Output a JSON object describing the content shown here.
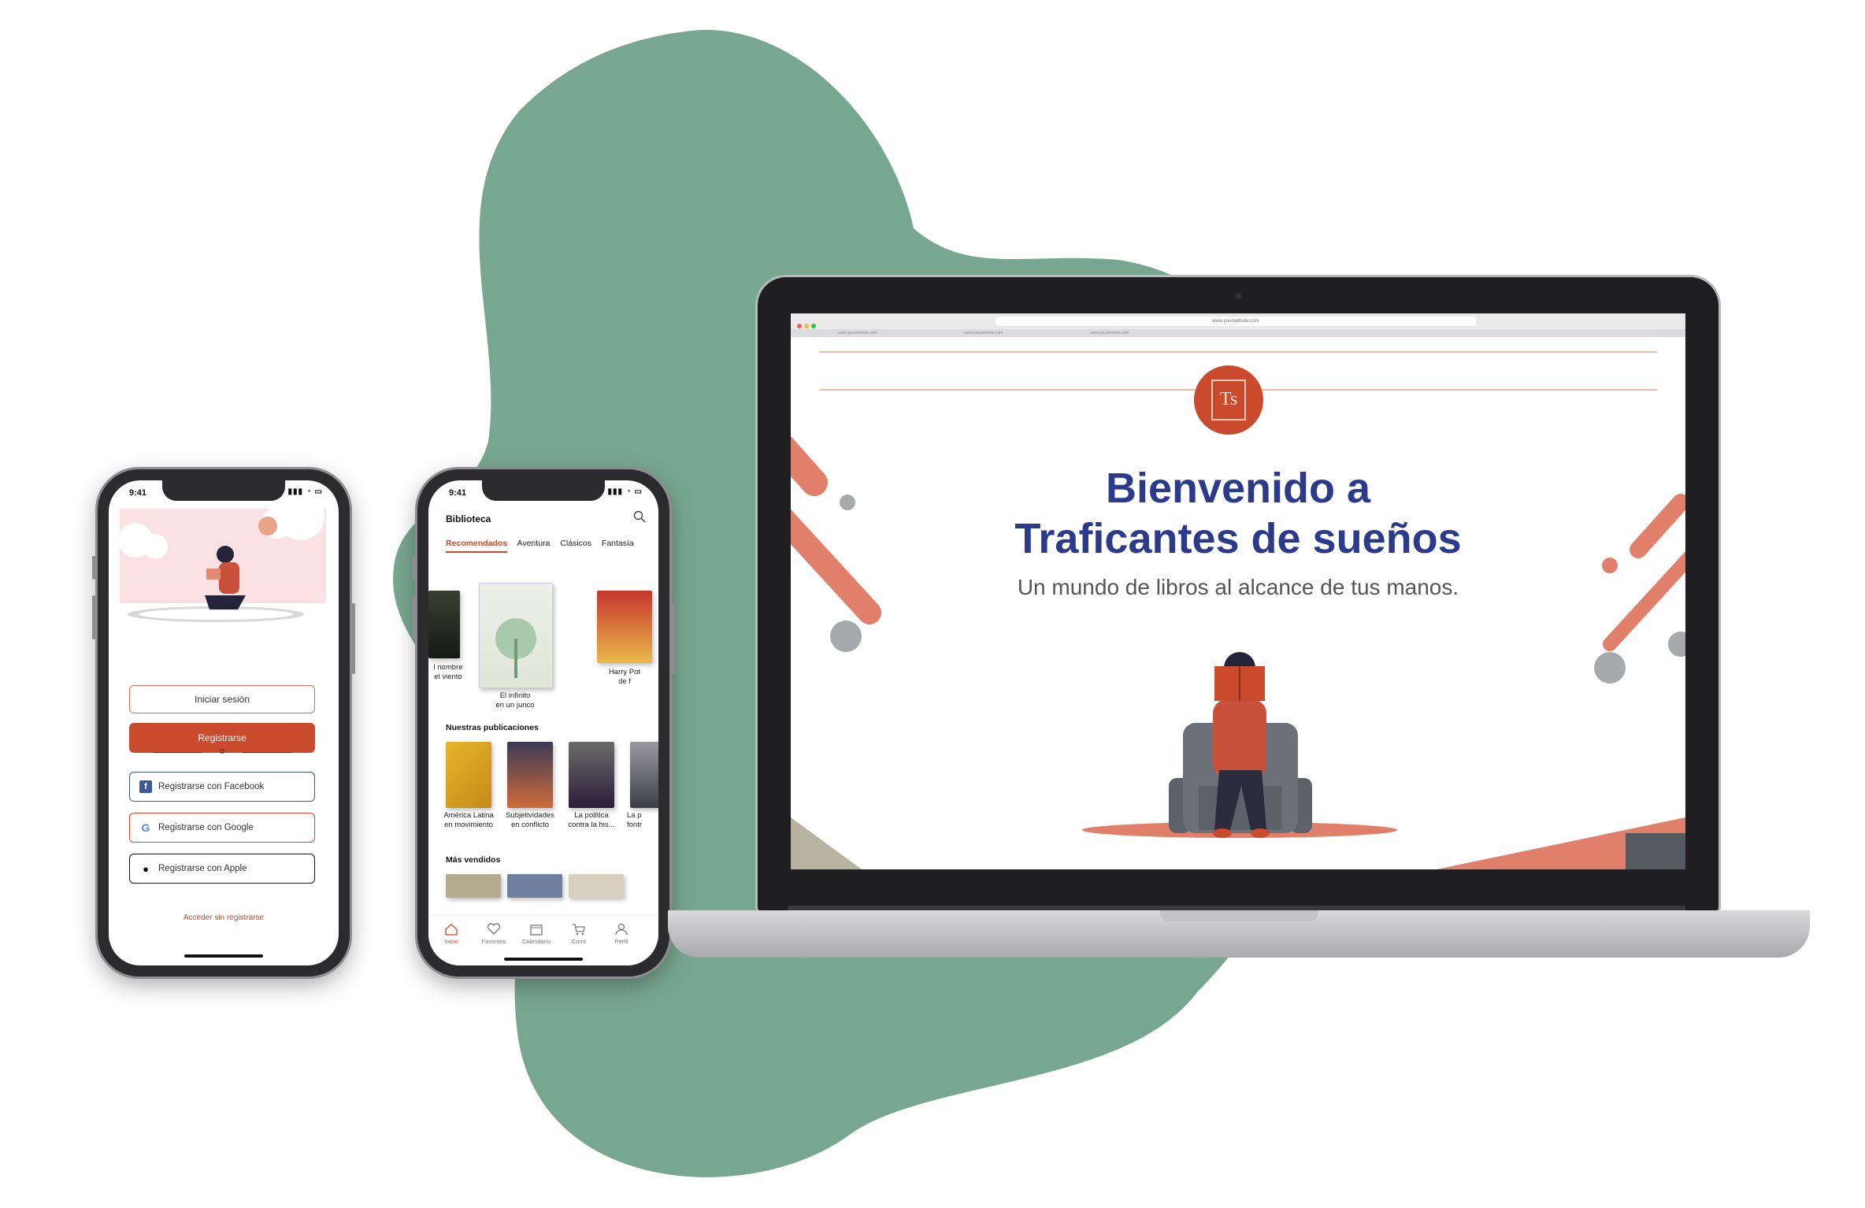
{
  "colors": {
    "accent": "#c94a2c",
    "blob": "#78a791",
    "headline": "#2b3a8a",
    "salmon": "#e0806a"
  },
  "phone_login": {
    "status_time": "9:41",
    "login_label": "Iniciar sesión",
    "register_label": "Registrarse",
    "or_label": "o",
    "facebook_label": "Registrarse con Facebook",
    "google_label": "Registrarse con Google",
    "apple_label": "Registrarse con Apple",
    "skip_label": "Acceder sin registrarse"
  },
  "phone_library": {
    "status_time": "9:41",
    "title": "Biblioteca",
    "tabs": [
      "Recomendados",
      "Aventura",
      "Clásicos",
      "Fantasía"
    ],
    "recommended": [
      {
        "caption": "l nombre\nel viento"
      },
      {
        "caption": "El infinito\nen un junco"
      },
      {
        "caption": "Harry Pot\nde f"
      }
    ],
    "section_publications": "Nuestras publicaciones",
    "publications": [
      {
        "caption": "América Latina\nen movimiento"
      },
      {
        "caption": "Subjetividades\nen conflicto"
      },
      {
        "caption": "La política\ncontra la his..."
      },
      {
        "caption": "La p\nfontr"
      }
    ],
    "section_bestsellers": "Más vendidos",
    "tabbar": [
      "Inicio",
      "Favoritos",
      "Calendario",
      "Carro",
      "Perfil"
    ]
  },
  "laptop": {
    "url": "www.yourwebsite.com",
    "browser_tabs": [
      "www.yourwebsite.com",
      "www.yourwebsite.com",
      "www.yourwebsite.com"
    ],
    "logo_text": "Ts",
    "headline_line1": "Bienvenido a",
    "headline_line2": "Traficantes de sueños",
    "subtitle": "Un mundo de libros al alcance de tus manos."
  }
}
